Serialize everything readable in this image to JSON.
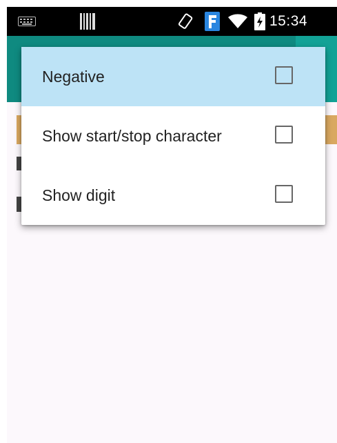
{
  "status_bar": {
    "time": "15:34",
    "icons": [
      "keyboard-icon",
      "barcode-icon",
      "rotate-icon",
      "f-app-icon",
      "wifi-icon",
      "battery-icon"
    ]
  },
  "options_menu": {
    "items": [
      {
        "label": "Negative",
        "checked": false,
        "highlighted": true
      },
      {
        "label": "Show start/stop character",
        "checked": false,
        "highlighted": false
      },
      {
        "label": "Show digit",
        "checked": false,
        "highlighted": false
      }
    ]
  },
  "colors": {
    "app_bar": "#0f8a80",
    "app_bar_accent": "#12a296",
    "highlight": "#bde3f6",
    "strip": "#d9a860",
    "background": "#fcf8fc"
  }
}
